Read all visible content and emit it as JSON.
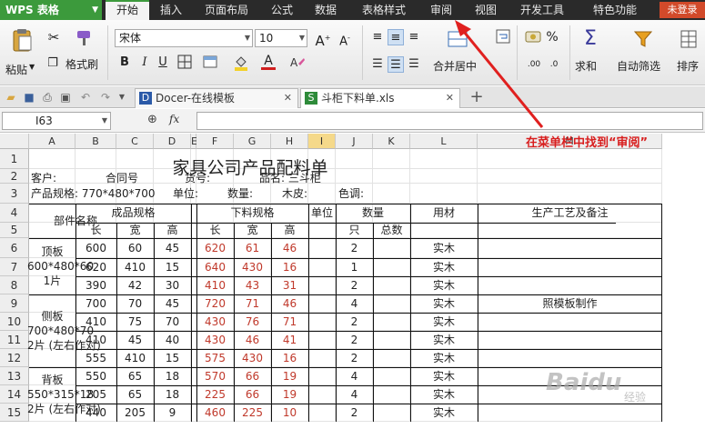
{
  "app": {
    "logo": "WPS 表格",
    "login": "未登录"
  },
  "menu": [
    "开始",
    "插入",
    "页面布局",
    "公式",
    "数据",
    "表格样式",
    "审阅",
    "视图",
    "开发工具",
    "特色功能"
  ],
  "ribbon": {
    "paste": "粘贴",
    "format_painter": "格式刷",
    "font_name": "宋体",
    "font_size": "10",
    "merge_center": "合并居中",
    "sum": "求和",
    "auto_filter": "自动筛选",
    "sort": "排序"
  },
  "doc_tabs": [
    {
      "label": "Docer-在线模板"
    },
    {
      "label": "斗柜下料单.xls"
    }
  ],
  "formula_bar": {
    "cell_ref": "I63",
    "fx": "fx"
  },
  "columns": [
    "A",
    "B",
    "C",
    "D",
    "E",
    "F",
    "G",
    "H",
    "I",
    "J",
    "K",
    "L",
    "M"
  ],
  "rows": [
    "1",
    "2",
    "3",
    "4",
    "5",
    "6",
    "7",
    "8",
    "9",
    "10",
    "11",
    "12",
    "13",
    "14",
    "15"
  ],
  "sheet": {
    "title": "家具公司产品配料单",
    "info1": [
      "客户:",
      "合同号",
      "货号:",
      "品名: 三斗柜"
    ],
    "info2": [
      "产品规格: 770*480*700",
      "单位:",
      "数量:",
      "木皮:",
      "色调:"
    ],
    "headers": {
      "part": "部件名称",
      "finished": "成品规格",
      "cut": "下料规格",
      "unit": "单位",
      "qty": "数量",
      "material": "用材",
      "process": "生产工艺及备注",
      "len": "长",
      "wid": "宽",
      "hgt": "高",
      "each": "只",
      "total": "总数"
    },
    "groups": [
      {
        "name": [
          "顶板",
          "600*480*60",
          "1片"
        ]
      },
      {
        "name": [
          "侧板",
          "700*480*70",
          "2片 (左右作对)"
        ]
      },
      {
        "name": [
          "背板",
          "550*315*18",
          "2片 (左右作对)"
        ]
      }
    ],
    "data": [
      [
        "600",
        "60",
        "45",
        "620",
        "61",
        "46",
        "2",
        "实木",
        ""
      ],
      [
        "620",
        "410",
        "15",
        "640",
        "430",
        "16",
        "1",
        "实木",
        ""
      ],
      [
        "390",
        "42",
        "30",
        "410",
        "43",
        "31",
        "2",
        "实木",
        ""
      ],
      [
        "700",
        "70",
        "45",
        "720",
        "71",
        "46",
        "4",
        "实木",
        "照模板制作"
      ],
      [
        "410",
        "75",
        "70",
        "430",
        "76",
        "71",
        "2",
        "实木",
        ""
      ],
      [
        "410",
        "45",
        "40",
        "430",
        "46",
        "41",
        "2",
        "实木",
        ""
      ],
      [
        "555",
        "410",
        "15",
        "575",
        "430",
        "16",
        "2",
        "实木",
        ""
      ],
      [
        "550",
        "65",
        "18",
        "570",
        "66",
        "19",
        "4",
        "实木",
        ""
      ],
      [
        "205",
        "65",
        "18",
        "225",
        "66",
        "19",
        "4",
        "实木",
        ""
      ],
      [
        "440",
        "205",
        "9",
        "460",
        "225",
        "10",
        "2",
        "实木",
        ""
      ]
    ]
  },
  "annotation": "在菜单栏中找到“审阅”",
  "watermark": {
    "main": "Baidu",
    "sub": "经验"
  }
}
